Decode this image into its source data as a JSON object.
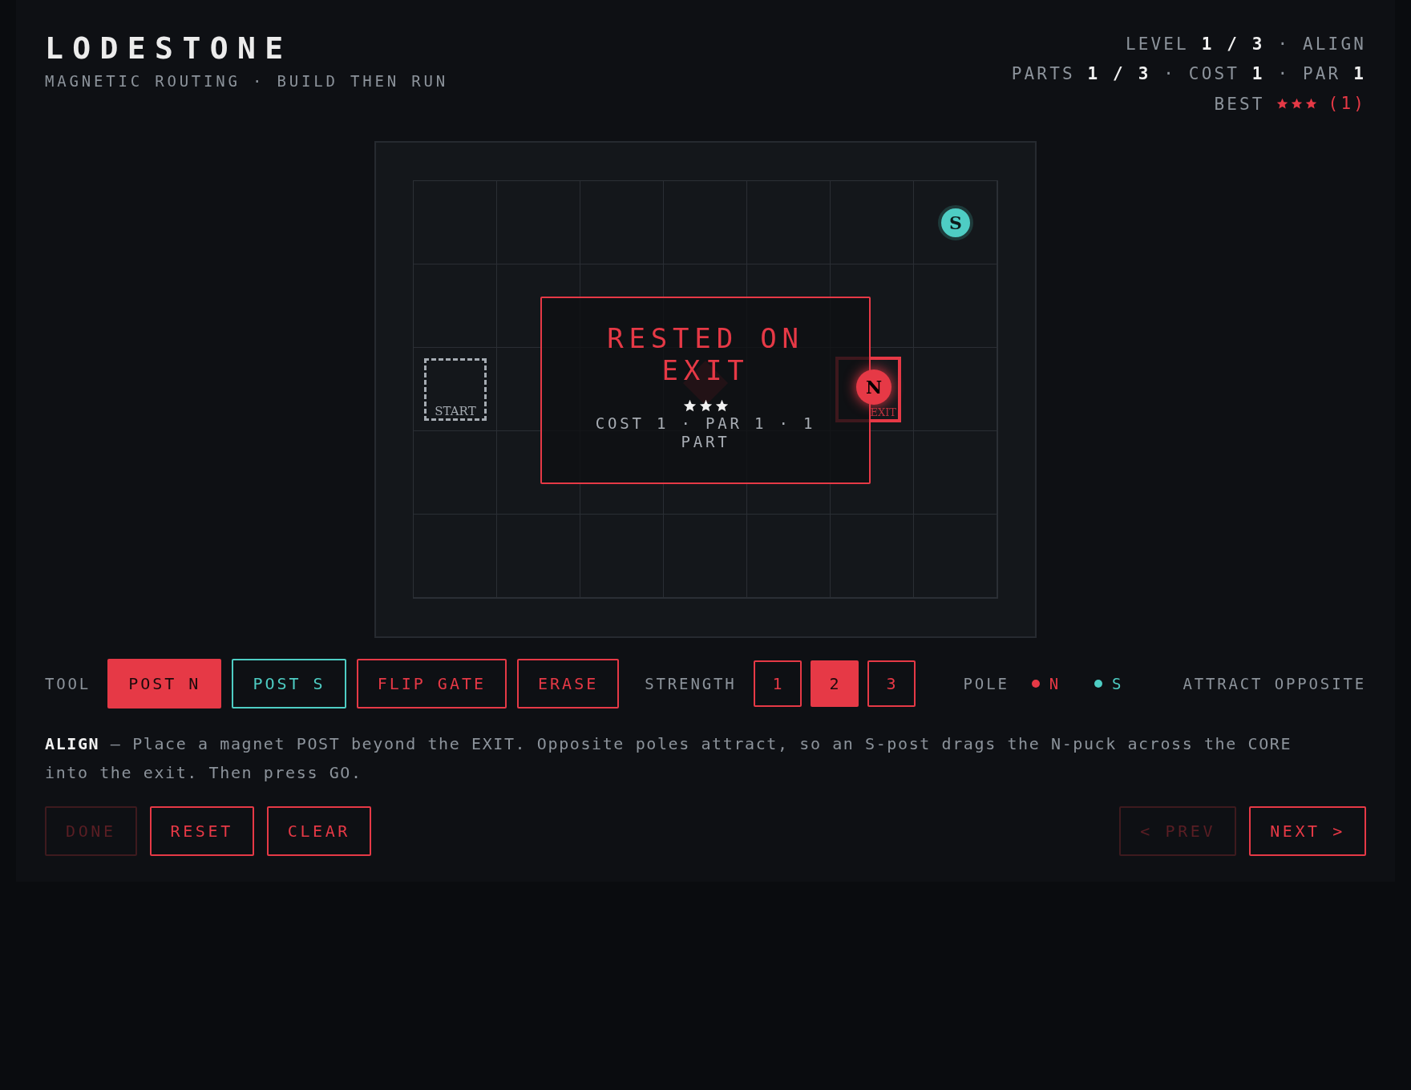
{
  "header": {
    "title": "LODESTONE",
    "subtitle": "MAGNETIC ROUTING · BUILD THEN RUN"
  },
  "stats": {
    "lines": [
      "LEVEL **1 / 3** · ALIGN",
      "PARTS **1 / 3** · COST **1** · PAR **1**"
    ],
    "best": {
      "label": "BEST",
      "stars": 3,
      "count": "(1)"
    }
  },
  "board": {
    "rows": [
      [
        {
          "kind": "empty"
        },
        {
          "kind": "empty"
        },
        {
          "kind": "empty"
        },
        {
          "kind": "empty"
        },
        {
          "kind": "empty"
        },
        {
          "kind": "empty"
        },
        {
          "kind": "post",
          "label": "S",
          "color": "#4ecdc4"
        }
      ],
      [
        {
          "kind": "empty"
        },
        {
          "kind": "empty"
        },
        {
          "kind": "empty"
        },
        {
          "kind": "empty"
        },
        {
          "kind": "empty"
        },
        {
          "kind": "empty"
        },
        {
          "kind": "empty"
        }
      ],
      [
        {
          "kind": "start",
          "label": "START"
        },
        {
          "kind": "empty"
        },
        {
          "kind": "empty"
        },
        {
          "kind": "core"
        },
        {
          "kind": "empty"
        },
        {
          "kind": "exit",
          "label": "EXIT",
          "puck": {
            "label": "N",
            "color": "#e63946"
          }
        },
        {
          "kind": "empty"
        }
      ],
      [
        {
          "kind": "empty"
        },
        {
          "kind": "empty"
        },
        {
          "kind": "empty"
        },
        {
          "kind": "empty"
        },
        {
          "kind": "empty"
        },
        {
          "kind": "empty"
        },
        {
          "kind": "empty"
        }
      ],
      [
        {
          "kind": "empty"
        },
        {
          "kind": "empty"
        },
        {
          "kind": "empty"
        },
        {
          "kind": "empty"
        },
        {
          "kind": "empty"
        },
        {
          "kind": "empty"
        },
        {
          "kind": "empty"
        }
      ]
    ]
  },
  "result": {
    "title": "RESTED ON EXIT",
    "stars": 3,
    "detail": "COST 1 · PAR 1 · 1 PART"
  },
  "toolbar": {
    "label": "TOOL",
    "tools": [
      {
        "label": "POST N",
        "selected": true,
        "color": "#e63946"
      },
      {
        "label": "POST S",
        "selected": false,
        "color": "#4ecdc4"
      },
      {
        "label": "FLIP GATE",
        "selected": false,
        "color": "#e63946"
      },
      {
        "label": "ERASE",
        "selected": false,
        "color": "#e63946"
      }
    ],
    "strength_label": "STRENGTH",
    "strengths": [
      {
        "label": "1",
        "selected": false
      },
      {
        "label": "2",
        "selected": true
      },
      {
        "label": "3",
        "selected": false
      }
    ],
    "pole_label": "POLE",
    "poles": [
      {
        "label": "N",
        "color": "#e63946"
      },
      {
        "label": "S",
        "color": "#4ecdc4"
      }
    ],
    "pole_hint": "ATTRACT OPPOSITE"
  },
  "description": "**ALIGN** — Place a magnet POST beyond the EXIT. Opposite poles attract, so an S-post drags the N-puck across the CORE into the exit. Then press GO.",
  "actions": {
    "left": [
      {
        "label": "DONE",
        "disabled": true
      },
      {
        "label": "RESET",
        "disabled": false
      },
      {
        "label": "CLEAR",
        "disabled": false
      }
    ],
    "right": [
      {
        "label": "< PREV",
        "disabled": true
      },
      {
        "label": "NEXT >",
        "disabled": false
      }
    ]
  }
}
